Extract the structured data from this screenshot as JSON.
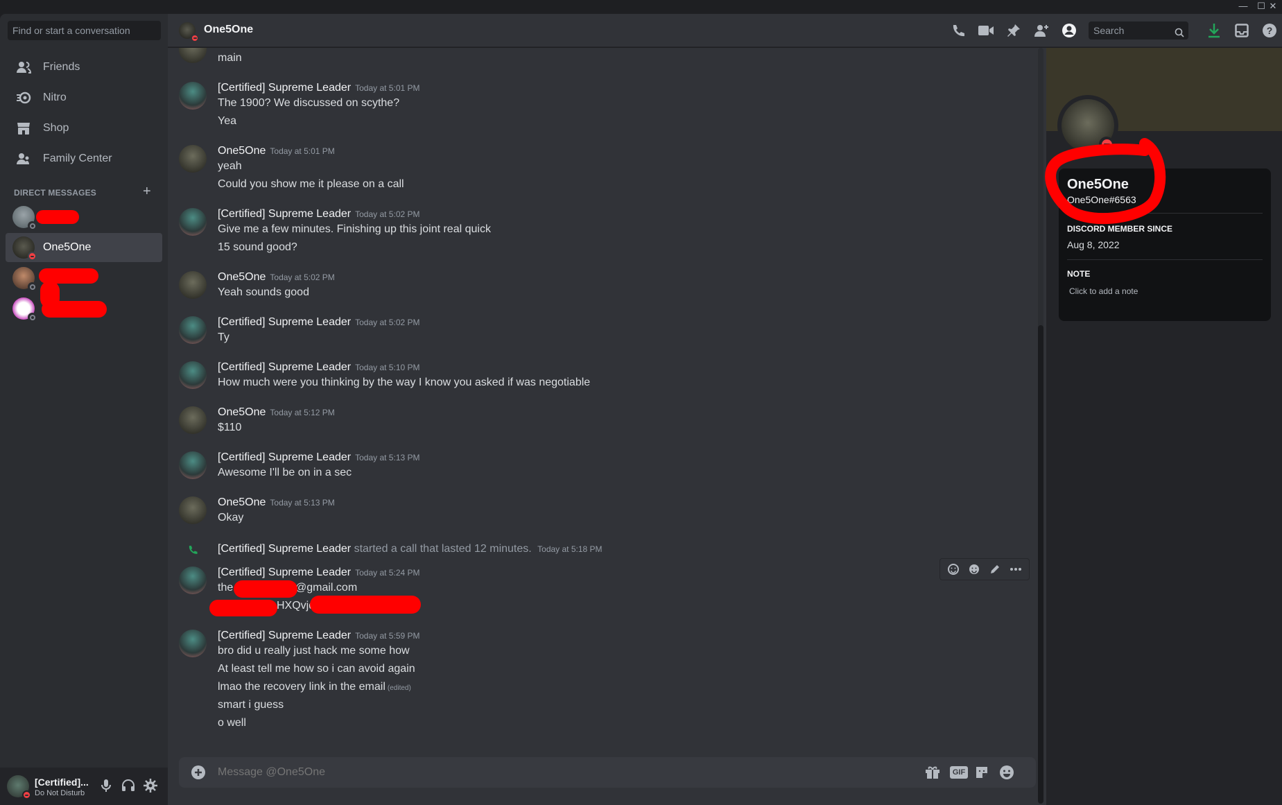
{
  "window": {
    "buttons": [
      "—",
      "☐",
      "✕"
    ]
  },
  "sidebar": {
    "search_placeholder": "Find or start a conversation",
    "nav": [
      {
        "label": "Friends",
        "icon": "friends-icon"
      },
      {
        "label": "Nitro",
        "icon": "nitro-icon"
      },
      {
        "label": "Shop",
        "icon": "shop-icon"
      },
      {
        "label": "Family Center",
        "icon": "family-center-icon"
      }
    ],
    "dm_header": "DIRECT MESSAGES",
    "dms": [
      {
        "label": "",
        "status": "offline"
      },
      {
        "label": "One5One",
        "status": "dnd",
        "active": true
      },
      {
        "label": "",
        "status": "offline"
      },
      {
        "label": "",
        "status": "offline"
      }
    ]
  },
  "user_panel": {
    "name": "[Certified]...",
    "status": "Do Not Disturb"
  },
  "header": {
    "title": "One5One",
    "search_placeholder": "Search"
  },
  "messages": [
    {
      "lines": [
        "main"
      ],
      "partial": true
    },
    {
      "author": "[Certified] Supreme Leader",
      "time": "Today at 5:01 PM",
      "lines": [
        "The 1900? We discussed on scythe?",
        "Yea"
      ]
    },
    {
      "author": "One5One",
      "time": "Today at 5:01 PM",
      "lines": [
        "yeah",
        "Could you show me it please on a call"
      ]
    },
    {
      "author": "[Certified] Supreme Leader",
      "time": "Today at 5:02 PM",
      "lines": [
        "Give me a few minutes. Finishing up this joint real quick",
        "15 sound good?"
      ]
    },
    {
      "author": "One5One",
      "time": "Today at 5:02 PM",
      "lines": [
        "Yeah sounds good"
      ]
    },
    {
      "author": "[Certified] Supreme Leader",
      "time": "Today at 5:02 PM",
      "lines": [
        "Ty"
      ]
    },
    {
      "author": "[Certified] Supreme Leader",
      "time": "Today at 5:10 PM",
      "lines": [
        "How much were you thinking by the way I know you asked if was negotiable"
      ]
    },
    {
      "author": "One5One",
      "time": "Today at 5:12 PM",
      "lines": [
        "$110"
      ]
    },
    {
      "author": "[Certified] Supreme Leader",
      "time": "Today at 5:13 PM",
      "lines": [
        "Awesome I'll be on in a sec"
      ]
    },
    {
      "author": "One5One",
      "time": "Today at 5:13 PM",
      "lines": [
        "Okay"
      ]
    },
    {
      "author": "[Certified] Supreme Leader",
      "time": "Today at 5:24 PM",
      "lines": [
        "the",
        "@gmail.com",
        "HXQvjd"
      ]
    },
    {
      "author": "[Certified] Supreme Leader",
      "time": "Today at 5:59 PM",
      "lines": [
        "bro did u really just hack me some how",
        "At least tell me how so i can avoid again",
        "lmao the recovery link in the email",
        "smart i guess",
        "o well"
      ],
      "edited": "(edited)"
    }
  ],
  "call_event": {
    "author": "[Certified] Supreme Leader",
    "text": "started a call that lasted 12 minutes.",
    "time": "Today at 5:18 PM"
  },
  "composer": {
    "placeholder": "Message @One5One",
    "gif_label": "GIF"
  },
  "profile": {
    "name": "One5One",
    "tag": "One5One#6563",
    "member_since_label": "DISCORD MEMBER SINCE",
    "member_since": "Aug 8, 2022",
    "note_label": "NOTE",
    "note_placeholder": "Click to add a note"
  },
  "colors": {
    "accent_green": "#23a55a",
    "dnd_red": "#f23f43",
    "redaction": "#ff0000"
  }
}
